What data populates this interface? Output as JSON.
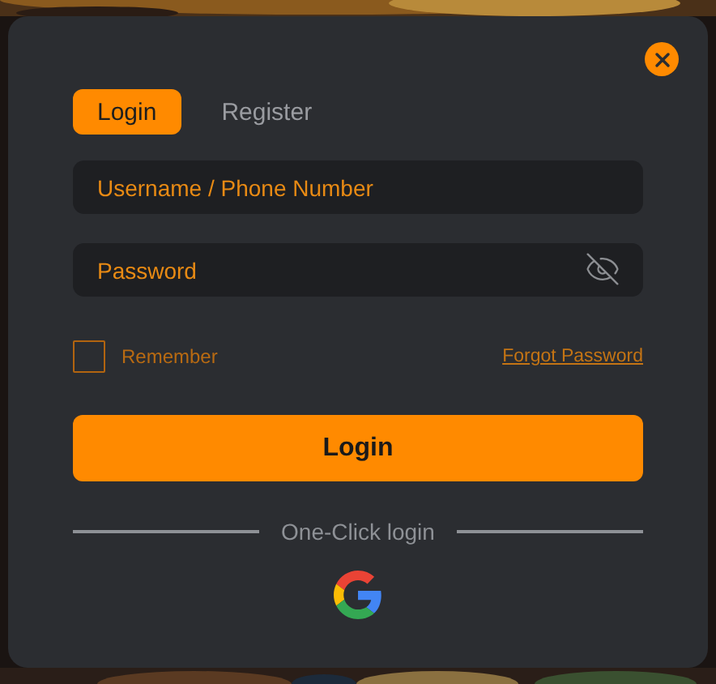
{
  "tabs": [
    {
      "label": "Login",
      "selected": true
    },
    {
      "label": "Register",
      "selected": false
    }
  ],
  "username": {
    "placeholder": "Username / Phone Number"
  },
  "password": {
    "placeholder": "Password"
  },
  "remember": {
    "label": "Remember",
    "checked": false
  },
  "forgot_link": "Forgot Password",
  "submit": "Login",
  "divider_text": "One-Click login"
}
